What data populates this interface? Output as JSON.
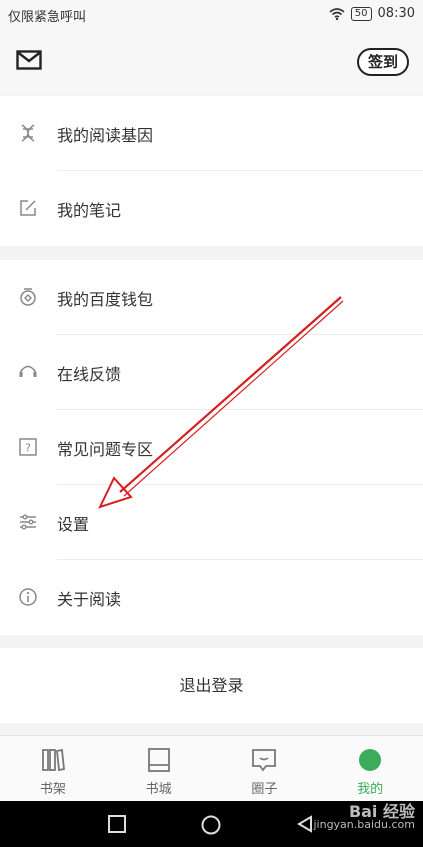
{
  "status_bar": {
    "carrier_text": "仅限紧急呼叫",
    "battery": "50",
    "time": "08:30"
  },
  "header": {
    "mail_icon": "mail-icon",
    "signin_label": "签到"
  },
  "menu_group_1": [
    {
      "label": "我的阅读基因",
      "icon": "dna-icon"
    },
    {
      "label": "我的笔记",
      "icon": "edit-note-icon"
    }
  ],
  "menu_group_2": [
    {
      "label": "我的百度钱包",
      "icon": "wallet-icon"
    },
    {
      "label": "在线反馈",
      "icon": "headset-icon"
    },
    {
      "label": "常见问题专区",
      "icon": "question-icon"
    },
    {
      "label": "设置",
      "icon": "sliders-icon"
    },
    {
      "label": "关于阅读",
      "icon": "info-icon"
    }
  ],
  "logout_label": "退出登录",
  "tabs": [
    {
      "label": "书架",
      "icon": "bookshelf-icon",
      "active": false
    },
    {
      "label": "书城",
      "icon": "bookstore-icon",
      "active": false
    },
    {
      "label": "圈子",
      "icon": "chat-icon",
      "active": false
    },
    {
      "label": "我的",
      "icon": "profile-icon",
      "active": true
    }
  ],
  "watermark": {
    "brand": "Bai 经验",
    "url": "jingyan.baidu.com"
  },
  "colors": {
    "accent": "#3cab5a",
    "annotation_arrow": "#d42020"
  }
}
